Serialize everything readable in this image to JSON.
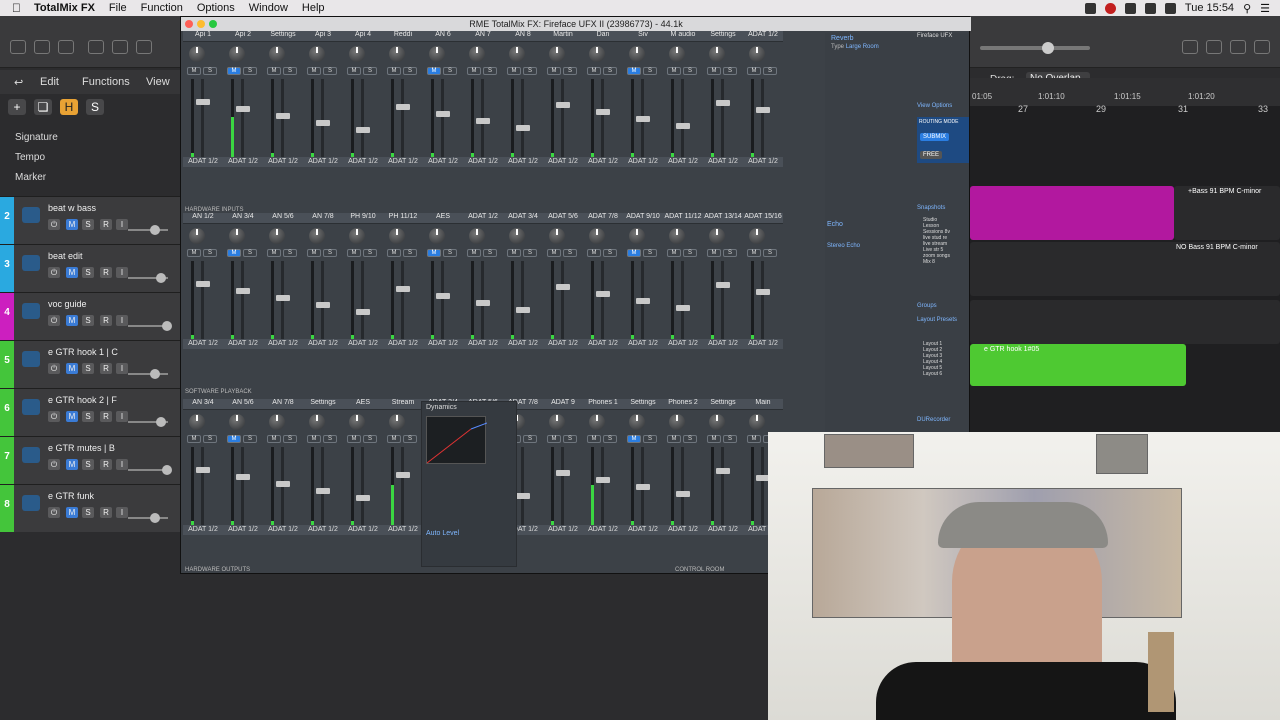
{
  "menubar": {
    "app": "TotalMix FX",
    "items": [
      "File",
      "Function",
      "Options",
      "Window",
      "Help"
    ],
    "time": "Tue 15:54"
  },
  "logic": {
    "menu": {
      "edit": "Edit",
      "functions": "Functions",
      "view": "View"
    },
    "drag_label": "Drag:",
    "drag_value": "No Overlap",
    "ruler": [
      "01:05",
      "1:01:10",
      "1:01:15",
      "1:01:20",
      "27",
      "29",
      "31",
      "33"
    ],
    "globals": [
      "Signature",
      "Tempo",
      "Marker"
    ],
    "tracks": [
      {
        "num": "2",
        "name": "beat w bass",
        "color": "#2aa9e0"
      },
      {
        "num": "3",
        "name": "beat edit",
        "color": "#2aa9e0"
      },
      {
        "num": "4",
        "name": "voc guide",
        "color": "#cc1fbf"
      },
      {
        "num": "5",
        "name": "e GTR hook 1 | C",
        "color": "#44c53b"
      },
      {
        "num": "6",
        "name": "e GTR hook 2 | F",
        "color": "#44c53b"
      },
      {
        "num": "7",
        "name": "e GTR mutes | B",
        "color": "#44c53b"
      },
      {
        "num": "8",
        "name": "e GTR funk",
        "color": "#44c53b"
      }
    ],
    "regions": {
      "bass": "+Bass 91 BPM C-minor",
      "bass2": "NO Bass 91 BPM C-minor",
      "hook": "e GTR hook 1#05"
    }
  },
  "totalmix": {
    "title": "RME TotalMix FX: Fireface UFX II (23986773) - 44.1k",
    "inputs": [
      "Api 1",
      "Api 2",
      "Settings",
      "Api 3",
      "Api 4",
      "Reddi",
      "AN 6",
      "AN 7",
      "AN 8",
      "Martin",
      "Dan",
      "Siv",
      "M audio",
      "Settings",
      "ADAT 1/2"
    ],
    "playback": [
      "AN 1/2",
      "AN 3/4",
      "AN 5/6",
      "AN 7/8",
      "PH 9/10",
      "PH 11/12",
      "AES",
      "ADAT 1/2",
      "ADAT 3/4",
      "ADAT 5/6",
      "ADAT 7/8",
      "ADAT 9/10",
      "ADAT 11/12",
      "ADAT 13/14",
      "ADAT 15/16"
    ],
    "outputs": [
      "AN 3/4",
      "AN 5/6",
      "AN 7/8",
      "Settings",
      "AES",
      "Stream",
      "ADAT 3/4",
      "ADAT 5/6",
      "ADAT 7/8",
      "ADAT 9",
      "Phones 1",
      "Settings",
      "Phones 2",
      "Settings",
      "Main"
    ],
    "row_labels": {
      "inputs": "HARDWARE INPUTS",
      "playback": "SOFTWARE PLAYBACK",
      "outputs": "HARDWARE OUTPUTS",
      "control": "CONTROL ROOM"
    },
    "foot": "ADAT 1/2",
    "panel": {
      "reverb": "Reverb",
      "preset": "Preset",
      "type": "Type",
      "room": "Large Room",
      "echo": "Echo",
      "echo_type": "Stereo Echo",
      "view_options": "View Options",
      "routing": "ROUTING MODE",
      "submix": "SUBMIX",
      "free": "FREE",
      "snapshots": "Snapshots",
      "groups": "Groups",
      "layout": "Layout Presets",
      "durec": "DURecorder",
      "device": "Fireface UFX",
      "snaps": [
        "Studio",
        "Lesson",
        "Sessions 8v",
        "live stud re",
        "live stream",
        "Live str 5",
        "zoom songs",
        "Mix 8"
      ],
      "layouts": [
        "Layout 1",
        "Layout 2",
        "Layout 3",
        "Layout 4",
        "Layout 5",
        "Layout 6"
      ]
    },
    "dynamics": "Dynamics",
    "auto_level": "Auto Level",
    "stream": "Stream"
  },
  "colors": {
    "accent": "#2a7de1",
    "meter": "#3bd742",
    "magenta": "#cc1fbf",
    "green": "#44c53b"
  }
}
